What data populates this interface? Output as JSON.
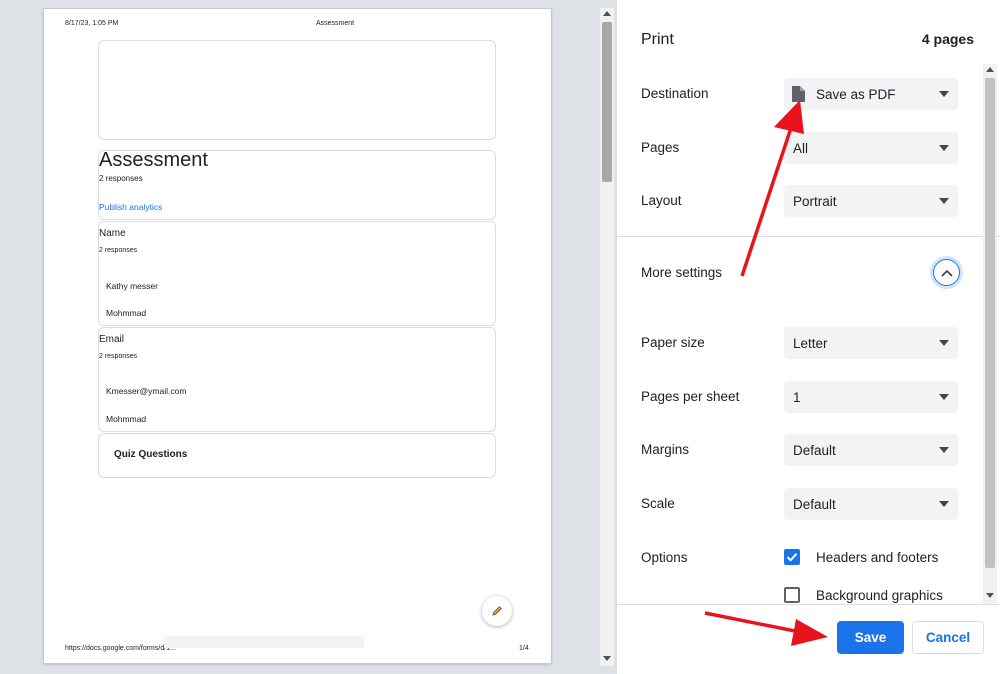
{
  "preview": {
    "header_left": "8/17/23, 1:05 PM",
    "header_center": "Assessment",
    "form_title": "Assessment",
    "form_responses": "2 responses",
    "publish_link": "Publish analytics",
    "questions": [
      {
        "label": "Name",
        "responses": "2 responses",
        "answers": [
          "Kathy messer",
          "Mohmmad"
        ]
      },
      {
        "label": "Email",
        "responses": "2 responses",
        "answers": [
          "Kmesser@ymail.com",
          "Mohmmad"
        ]
      }
    ],
    "section_title": "Quiz Questions",
    "footer_url": "https://docs.google.com/forms/d/1...",
    "footer_page": "1/4"
  },
  "print": {
    "title": "Print",
    "page_count": "4 pages",
    "rows": {
      "destination": {
        "label": "Destination",
        "value": "Save as PDF"
      },
      "pages": {
        "label": "Pages",
        "value": "All"
      },
      "layout": {
        "label": "Layout",
        "value": "Portrait"
      },
      "more_settings": {
        "label": "More settings"
      },
      "paper_size": {
        "label": "Paper size",
        "value": "Letter"
      },
      "pages_per_sheet": {
        "label": "Pages per sheet",
        "value": "1"
      },
      "margins": {
        "label": "Margins",
        "value": "Default"
      },
      "scale": {
        "label": "Scale",
        "value": "Default"
      },
      "options": {
        "label": "Options",
        "headers_footers": {
          "label": "Headers and footers",
          "checked": true
        },
        "background_graphics": {
          "label": "Background graphics",
          "checked": false
        }
      }
    },
    "save_label": "Save",
    "cancel_label": "Cancel"
  },
  "colors": {
    "accent": "#1a73e8",
    "annotation": "#e8141c"
  }
}
